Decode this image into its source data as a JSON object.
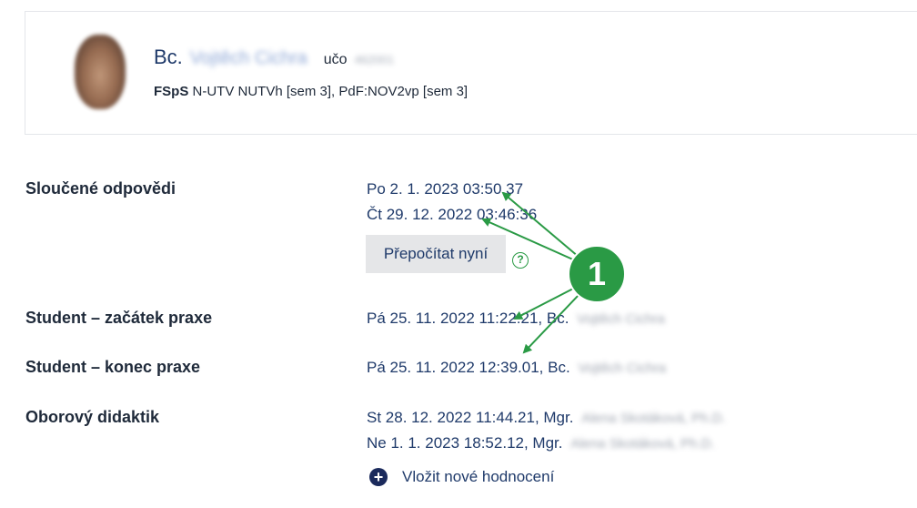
{
  "profile": {
    "title_prefix": "Bc.",
    "name_blurred": "Vojtěch Cichra",
    "uco_label": "učo",
    "uco_blurred": "462001",
    "study_faculty": "FSpS",
    "study_programs": "N-UTV NUTVh [sem 3], PdF:NOV2vp [sem 3]"
  },
  "rows": {
    "merged": {
      "label": "Sloučené odpovědi",
      "values": [
        "Po 2. 1. 2023 03:50.37",
        "Čt 29. 12. 2022 03:46:36"
      ]
    },
    "recalc_button": "Přepočítat nyní",
    "help_symbol": "?",
    "student_start": {
      "label": "Student – začátek praxe",
      "value": "Pá 25. 11. 2022 11:22:21, Bc.",
      "person_blurred": "Vojtěch Cichra"
    },
    "student_end": {
      "label": "Student – konec praxe",
      "value": "Pá 25. 11. 2022 12:39.01, Bc.",
      "person_blurred": "Vojtěch Cichra"
    },
    "didactic": {
      "label": "Oborový didaktik",
      "values": [
        "St 28. 12. 2022 11:44.21, Mgr.",
        "Ne 1. 1. 2023 18:52.12, Mgr."
      ],
      "person_blurred": "Alena Skotáková, Ph.D."
    },
    "add_rating": "Vložit nové hodnocení",
    "add_icon": "plus-icon"
  },
  "annotation": {
    "number": "1",
    "color": "#2a9a45"
  }
}
